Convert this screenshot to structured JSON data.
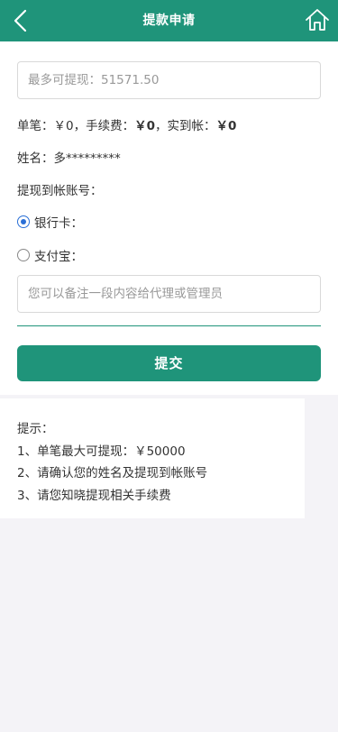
{
  "header": {
    "title": "提款申请",
    "back_icon": "chevron-left-icon",
    "home_icon": "home-icon"
  },
  "form": {
    "amount_placeholder": "最多可提现：51571.50",
    "fee_line": {
      "single_label": "单笔：",
      "single_value": "￥0",
      "fee_label": "，手续费：",
      "fee_value": "￥0",
      "received_label": "，实到帐：",
      "received_value": "￥0"
    },
    "name_label": "姓名：",
    "name_value": "多*********",
    "account_label": "提现到帐账号：",
    "options": [
      {
        "label": "银行卡：",
        "selected": true
      },
      {
        "label": "支付宝：",
        "selected": false
      }
    ],
    "remark_placeholder": "您可以备注一段内容给代理或管理员",
    "submit_label": "提交"
  },
  "tips": {
    "title": "提示：",
    "items": [
      "1、单笔最大可提现：￥50000",
      "2、请确认您的姓名及提现到帐账号",
      "3、请您知晓提现相关手续费"
    ]
  },
  "colors": {
    "brand": "#1f947a",
    "radio_selected": "#2a6fd6"
  }
}
